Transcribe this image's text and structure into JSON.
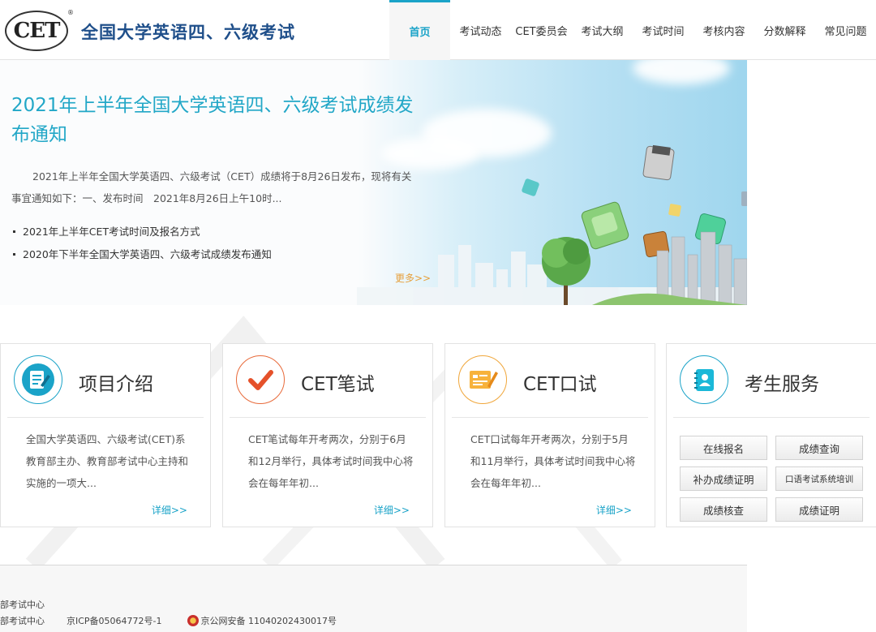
{
  "header": {
    "logo_text": "CET",
    "logo_reg": "®",
    "site_title": "全国大学英语四、六级考试",
    "nav": [
      "首页",
      "考试动态",
      "CET委员会",
      "考试大纲",
      "考试时间",
      "考核内容",
      "分数解释",
      "常见问题"
    ]
  },
  "banner": {
    "title": "2021年上半年全国大学英语四、六级考试成绩发布通知",
    "desc": "2021年上半年全国大学英语四、六级考试（CET）成绩将于8月26日发布，现将有关事宜通知如下：一、发布时间　2021年8月26日上午10时...",
    "links": [
      "2021年上半年CET考试时间及报名方式",
      "2020年下半年全国大学英语四、六级考试成绩发布通知"
    ],
    "more": "更多>>"
  },
  "cards": [
    {
      "title": "项目介绍",
      "text": "全国大学英语四、六级考试(CET)系教育部主办、教育部考试中心主持和实施的一项大...",
      "more": "详细>>",
      "icon": "document-edit-icon"
    },
    {
      "title": "CET笔试",
      "text": "CET笔试每年开考两次，分别于6月和12月举行，具体考试时间我中心将会在每年年初...",
      "more": "详细>>",
      "icon": "checkmark-icon"
    },
    {
      "title": "CET口试",
      "text": "CET口试每年开考两次，分别于5月和11月举行，具体考试时间我中心将会在每年年初...",
      "more": "详细>>",
      "icon": "pencil-form-icon"
    }
  ],
  "services": {
    "title": "考生服务",
    "icon": "notebook-user-icon",
    "buttons": [
      "在线报名",
      "成绩查询",
      "补办成绩证明",
      "口语考试系统培训",
      "成绩核查",
      "成绩证明"
    ]
  },
  "footer": {
    "line1": "部考试中心",
    "line2_org": "部考试中心",
    "icp": "京ICP备05064772号-1",
    "police": "京公网安备 11040202430017号"
  },
  "colors": {
    "accent": "#1aa3c8",
    "title_blue": "#1f4f8a",
    "more_orange": "#e6a03c"
  }
}
